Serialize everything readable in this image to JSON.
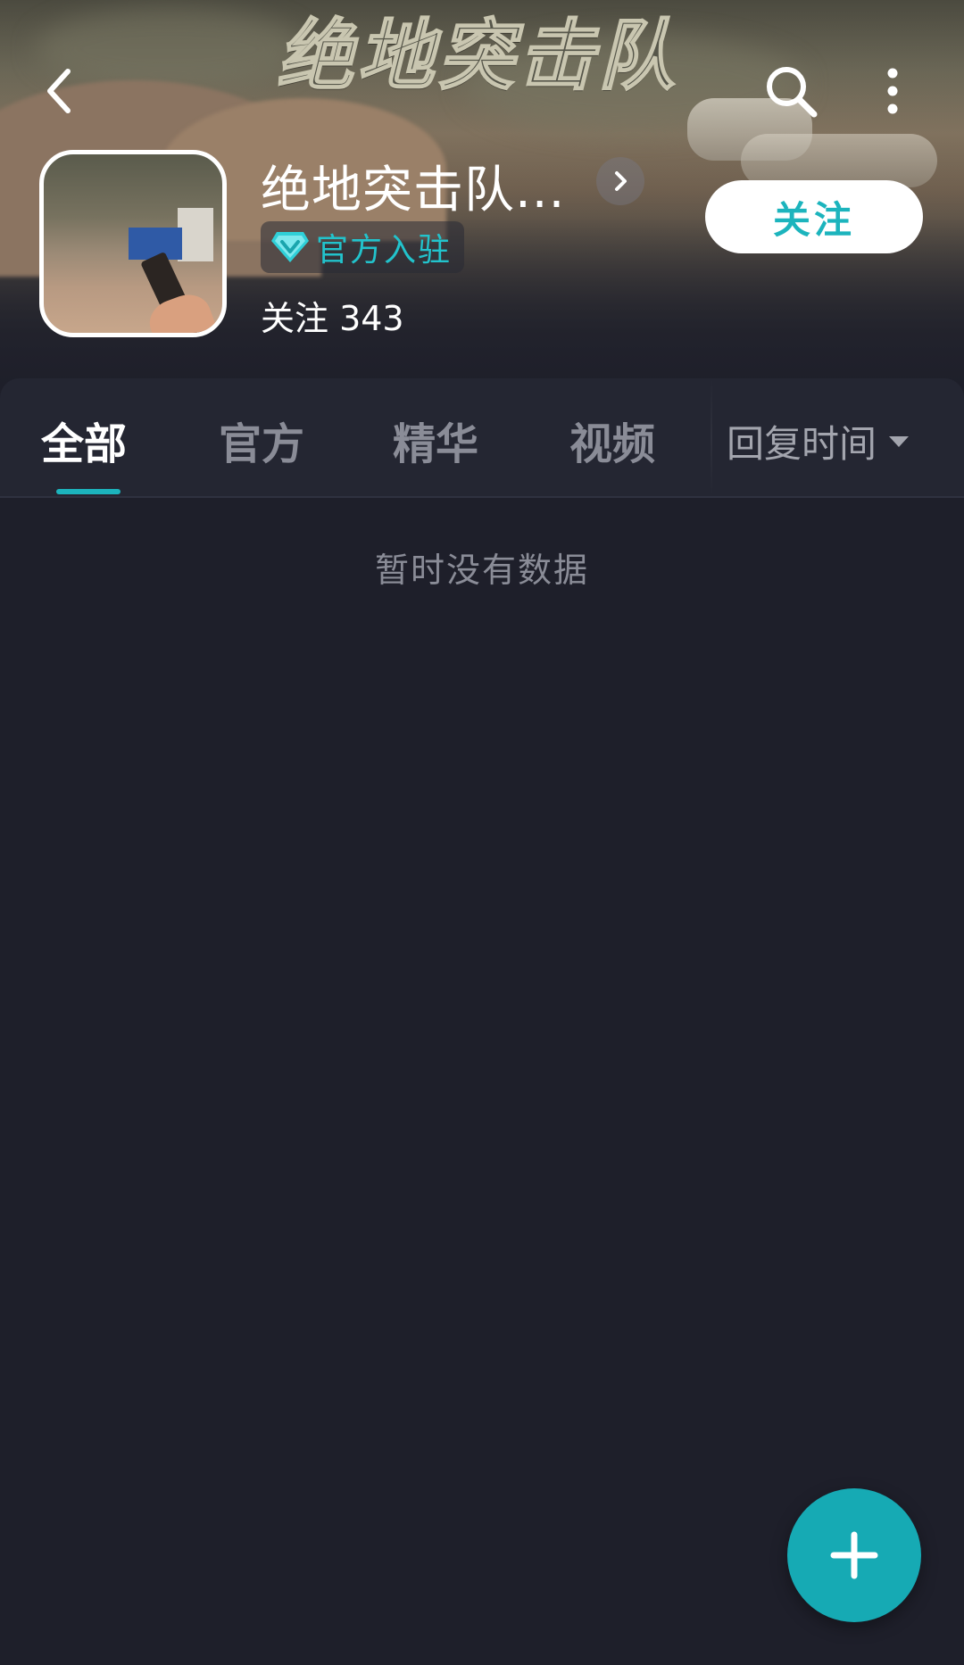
{
  "header": {
    "banner_title": "绝地突击队",
    "game_name": "绝地突击队...",
    "official_badge": "官方入驻",
    "follow_count": "关注 343",
    "follow_button": "关注"
  },
  "tabs": [
    {
      "label": "全部",
      "active": true
    },
    {
      "label": "官方",
      "active": false
    },
    {
      "label": "精华",
      "active": false
    },
    {
      "label": "视频",
      "active": false
    }
  ],
  "sort": {
    "label": "回复时间"
  },
  "empty_state": "暂时没有数据",
  "icons": {
    "back": "chevron-left-icon",
    "search": "search-icon",
    "more": "more-vertical-icon",
    "detail": "chevron-right-icon",
    "badge": "diamond-v-icon",
    "sort": "caret-down-icon",
    "fab": "plus-icon"
  },
  "colors": {
    "accent": "#1cb4bd",
    "background": "#1e1f2a",
    "tabs_background": "#242632",
    "inactive_text": "#8a8c97"
  }
}
